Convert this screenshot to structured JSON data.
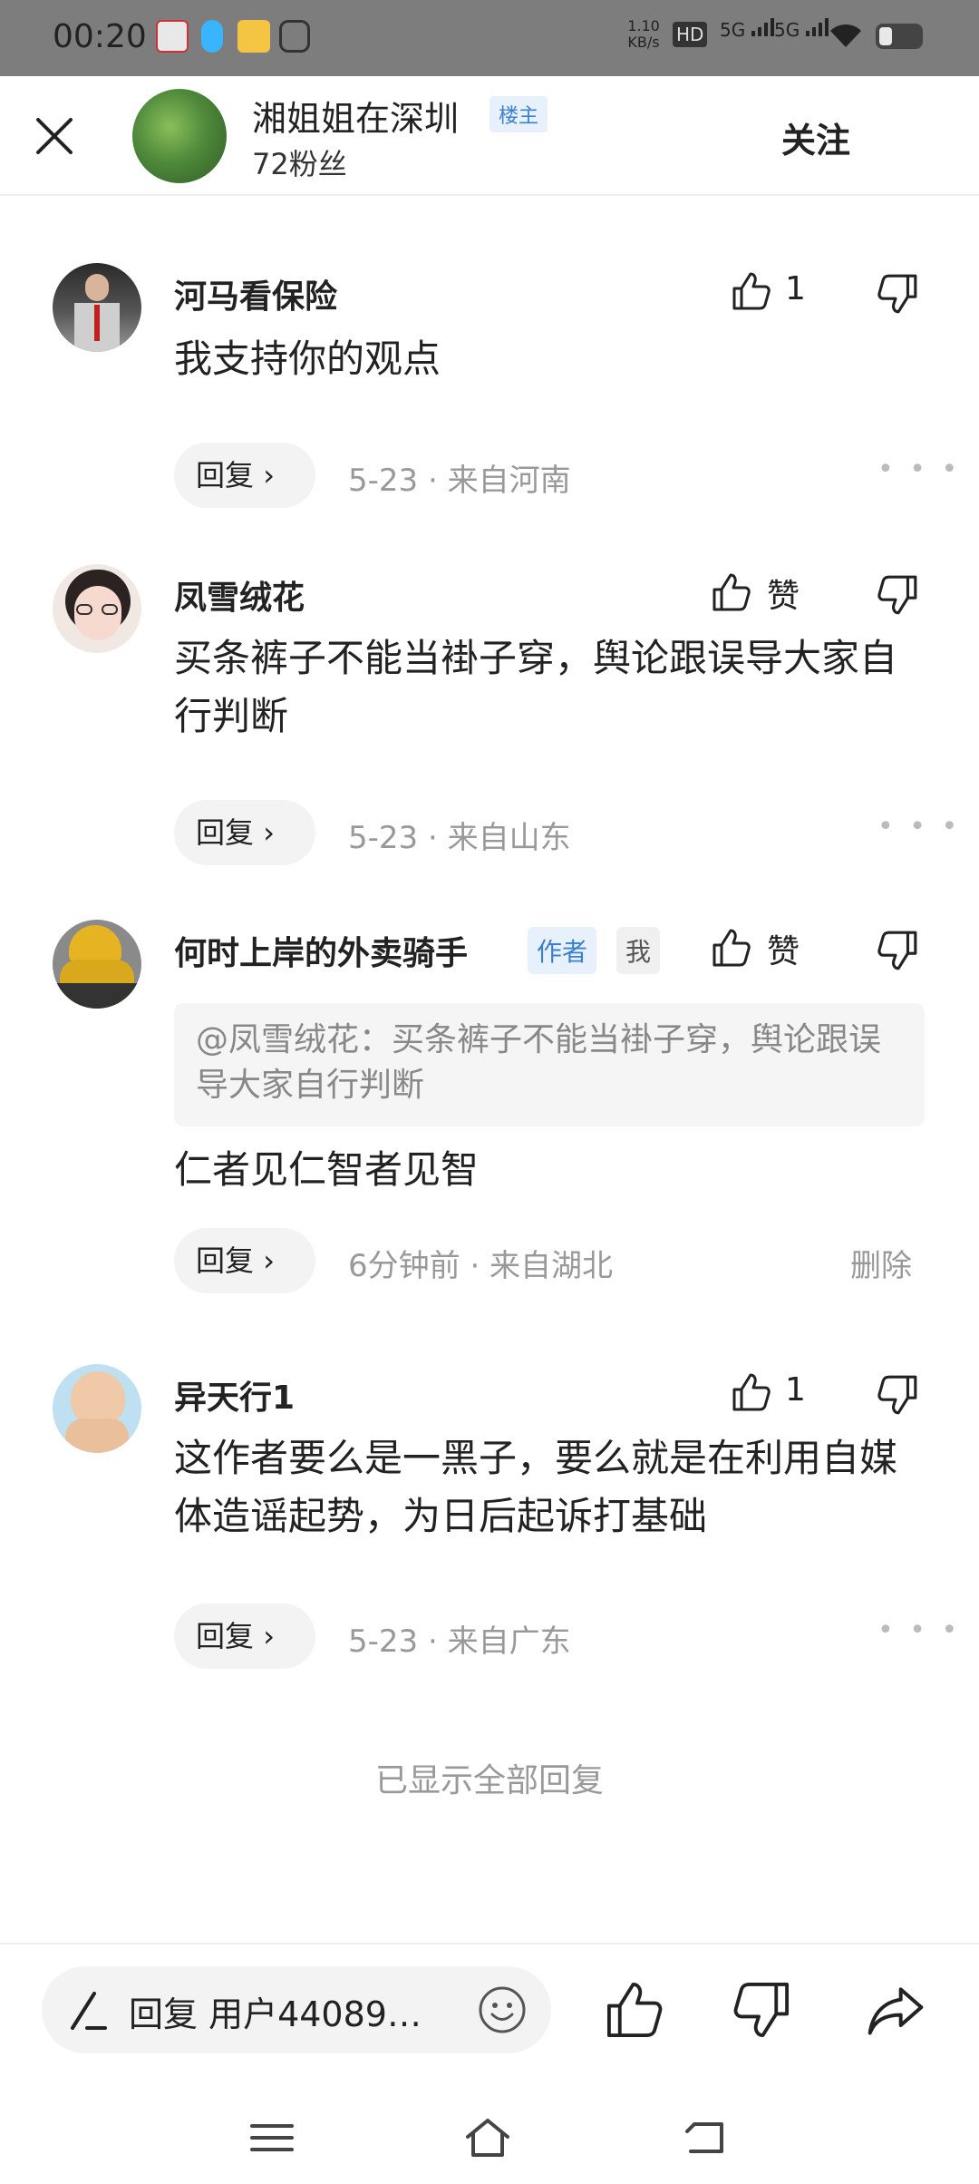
{
  "status_bar": {
    "time": "00:20",
    "net_speed": "1.10 KB/s",
    "signal_1": "5G",
    "signal_2": "5G"
  },
  "header": {
    "name": "湘姐姐在深圳",
    "owner_tag": "楼主",
    "fans": "72粉丝",
    "follow_label": "关注"
  },
  "comments": [
    {
      "name": "河马看保险",
      "text": "我支持你的观点",
      "like": "1",
      "reply_label": "回复",
      "meta": "5-23 · 来自河南"
    },
    {
      "name": "凤雪绒花",
      "text": "买条裤子不能当褂子穿，舆论跟误导大家自行判断",
      "like": "赞",
      "reply_label": "回复",
      "meta": "5-23 · 来自山东"
    },
    {
      "name": "何时上岸的外卖骑手",
      "author_tag": "作者",
      "me_tag": "我",
      "quote": "@凤雪绒花：买条裤子不能当褂子穿，舆论跟误导大家自行判断",
      "text": "仁者见仁智者见智",
      "like": "赞",
      "reply_label": "回复",
      "meta": "6分钟前 · 来自湖北",
      "delete_label": "删除"
    },
    {
      "name": "异天行1",
      "text": "这作者要么是一黑子，要么就是在利用自媒体造谣起势，为日后起诉打基础",
      "like": "1",
      "reply_label": "回复",
      "meta": "5-23 · 来自广东"
    }
  ],
  "all_shown": "已显示全部回复",
  "bottom_bar": {
    "reply_placeholder": "回复 用户44089…"
  },
  "icons": {
    "close": "close-icon",
    "like": "thumbs-up-icon",
    "dislike": "thumbs-down-icon",
    "share": "share-icon",
    "emoji": "emoji-icon",
    "pen": "pen-icon",
    "menu": "menu-icon",
    "home": "home-icon",
    "back": "back-icon"
  },
  "colors": {
    "accent_blue": "#3b7fd0",
    "tag_bg": "#e7f1fb",
    "meta_gray": "#999999"
  }
}
